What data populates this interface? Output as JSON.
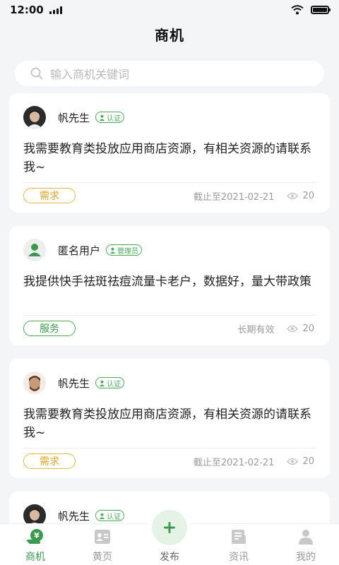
{
  "status_bar": {
    "time": "12:00"
  },
  "header": {
    "title": "商机"
  },
  "search": {
    "placeholder": "输入商机关键词"
  },
  "colors": {
    "accent_green": "#3c9a4e",
    "demand_yellow": "#d9a52a",
    "background": "#f4f5f7"
  },
  "posts": [
    {
      "name": "帆先生",
      "badge": "认证",
      "content": "我需要教育类投放应用商店资源，有相关资源的请联系我~",
      "tag": "需求",
      "deadline": "截止至2021-02-21",
      "views": "20"
    },
    {
      "name": "匿名用户",
      "badge": "管理员",
      "content": "我提供快手祛斑祛痘流量卡老户，数据好，量大带政策",
      "tag": "服务",
      "deadline": "长期有效",
      "views": "20"
    },
    {
      "name": "帆先生",
      "badge": "认证",
      "content": "我需要教育类投放应用商店资源，有相关资源的请联系我~",
      "tag": "需求",
      "deadline": "截止至2021-02-21",
      "views": "20"
    },
    {
      "name": "帆先生",
      "badge": "认证"
    }
  ],
  "tabbar": {
    "items": [
      {
        "label": "商机",
        "icon": "opportunity-icon",
        "active": true
      },
      {
        "label": "黄页",
        "icon": "yellow-pages-icon"
      },
      {
        "label": "发布",
        "icon": "plus-icon"
      },
      {
        "label": "资讯",
        "icon": "news-icon"
      },
      {
        "label": "我的",
        "icon": "profile-icon"
      }
    ]
  }
}
